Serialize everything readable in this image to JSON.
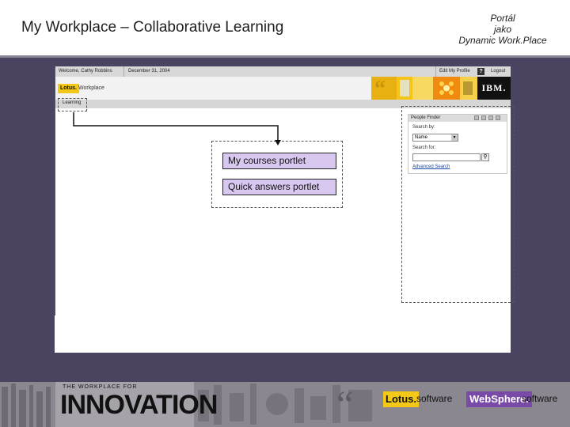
{
  "slide": {
    "title": "My Workplace – Collaborative Learning",
    "note_line1": "Portál",
    "note_line2": "jako",
    "note_line3": "Dynamic Work.Place"
  },
  "portal": {
    "welcome": "Welcome, Cathy Robbins",
    "date": "December 31, 2004",
    "edit_profile": "Edit My Profile",
    "help": "?",
    "logout": "Logout",
    "lotus_logo": "Lotus.",
    "workplace": "Workplace",
    "ibm_logo": "IBM.",
    "learning_tab": "Learning"
  },
  "portlets": {
    "my_courses": "My courses portlet",
    "quick_answers": "Quick answers portlet"
  },
  "people_finder": {
    "title": "People Finder",
    "search_by_label": "Search by:",
    "search_by_value": "Name",
    "search_for_label": "Search for:",
    "search_for_value": "",
    "advanced_search": "Advanced Search"
  },
  "footer": {
    "tagline_small": "THE WORKPLACE FOR",
    "tagline_big": "INNOVATION",
    "lotus": "Lotus.",
    "lotus_software": "software",
    "websphere": "WebSphere.",
    "websphere_software": "software"
  },
  "colors": {
    "background": "#4a4460",
    "portlet_fill": "#d8c8f0",
    "lotus_yellow": "#f3c816",
    "websphere_purple": "#7a4aa8"
  }
}
